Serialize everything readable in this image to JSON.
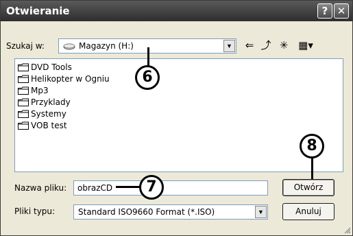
{
  "window": {
    "title": "Otwieranie",
    "help_glyph": "?",
    "close_glyph": "✕"
  },
  "lookin": {
    "label": "Szukaj w:",
    "value": "Magazyn (H:)",
    "icon": "drive-icon"
  },
  "toolbar": {
    "back_glyph": "⇐",
    "up_glyph": "⤴",
    "newfolder_glyph": "✳",
    "views_glyph": "▦▾"
  },
  "files": [
    "DVD Tools",
    "Helikopter w Ogniu",
    "Mp3",
    "Przyklady",
    "Systemy",
    "VOB test"
  ],
  "filename": {
    "label": "Nazwa pliku:",
    "value": "obrazCD"
  },
  "filetype": {
    "label": "Pliki typu:",
    "value": "Standard ISO9660 Format (*.ISO)"
  },
  "buttons": {
    "open": "Otwórz",
    "cancel": "Anuluj"
  },
  "callouts": {
    "c6": "6",
    "c7": "7",
    "c8": "8"
  },
  "colors": {
    "titlebar": "#3a3a3a",
    "dialog_bg": "#ece9d8",
    "field_border": "#7f9db9"
  }
}
